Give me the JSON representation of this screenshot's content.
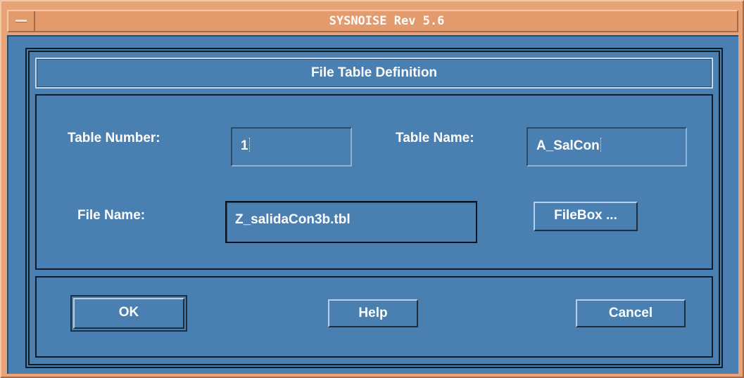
{
  "window": {
    "title": "SYSNOISE Rev 5.6"
  },
  "dialog": {
    "header": "File Table Definition",
    "table_number_label": "Table Number:",
    "table_number_value": "1",
    "table_name_label": "Table Name:",
    "table_name_value": "A_SalCon",
    "file_name_label": "File Name:",
    "file_name_value": "Z_salidaCon3b.tbl",
    "filebox_label": "FileBox ...",
    "ok_label": "OK",
    "help_label": "Help",
    "cancel_label": "Cancel"
  },
  "icons": {
    "window_menu": "window-menu-icon"
  },
  "colors": {
    "title_bar": "#e39a6c",
    "dialog_background": "#4a7fb2",
    "text": "#ffffff"
  }
}
